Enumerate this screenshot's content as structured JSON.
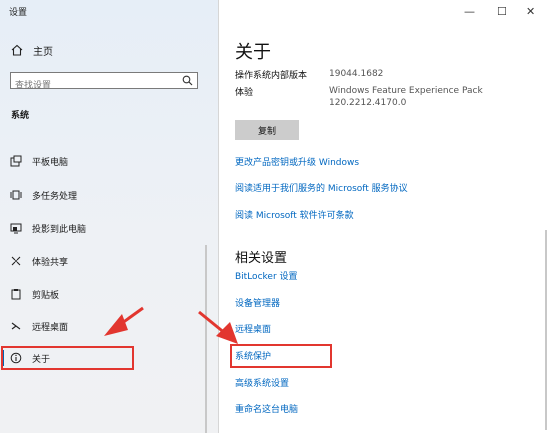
{
  "window": {
    "title": "设置"
  },
  "sidebar": {
    "home_label": "主页",
    "search_placeholder": "查找设置",
    "section_label": "系统",
    "items": [
      {
        "label": "平板电脑",
        "icon": "tablet-icon"
      },
      {
        "label": "多任务处理",
        "icon": "multitasking-icon"
      },
      {
        "label": "投影到此电脑",
        "icon": "projecting-icon"
      },
      {
        "label": "体验共享",
        "icon": "shared-experiences-icon"
      },
      {
        "label": "剪贴板",
        "icon": "clipboard-icon"
      },
      {
        "label": "远程桌面",
        "icon": "remote-desktop-icon"
      },
      {
        "label": "关于",
        "icon": "info-icon",
        "selected": true
      }
    ]
  },
  "window_controls": {
    "minimize": "—",
    "maximize": "☐",
    "close": "✕"
  },
  "main": {
    "title": "关于",
    "specs": [
      {
        "label": "操作系统内部版本",
        "value": "19044.1682"
      },
      {
        "label": "体验",
        "value": "Windows Feature Experience Pack 120.2212.4170.0"
      }
    ],
    "copy_button": "复制",
    "links": [
      "更改产品密钥或升级 Windows",
      "阅读适用于我们服务的 Microsoft 服务协议",
      "阅读 Microsoft 软件许可条款"
    ],
    "related_title": "相关设置",
    "related_links": [
      "BitLocker 设置",
      "设备管理器",
      "远程桌面",
      "系统保护",
      "高级系统设置",
      "重命名这台电脑"
    ]
  },
  "colors": {
    "accent": "#0067c0",
    "highlight_red": "#e2362f",
    "sidebar_bg": "#eef1f5",
    "button_bg": "#cccccc"
  }
}
